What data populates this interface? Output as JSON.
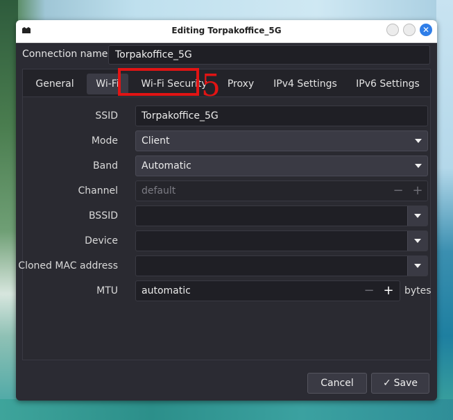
{
  "window": {
    "title": "Editing Torpakoffice_5G"
  },
  "connection": {
    "label": "Connection name",
    "value": "Torpakoffice_5G"
  },
  "tabs": [
    {
      "label": "General"
    },
    {
      "label": "Wi-Fi",
      "active": true
    },
    {
      "label": "Wi-Fi Security"
    },
    {
      "label": "Proxy"
    },
    {
      "label": "IPv4 Settings"
    },
    {
      "label": "IPv6 Settings"
    }
  ],
  "annotation": {
    "number": "5",
    "color": "#e11414"
  },
  "fields": {
    "ssid": {
      "label": "SSID",
      "value": "Torpakoffice_5G"
    },
    "mode": {
      "label": "Mode",
      "value": "Client"
    },
    "band": {
      "label": "Band",
      "value": "Automatic"
    },
    "channel": {
      "label": "Channel",
      "placeholder": "default",
      "minus": "−",
      "plus": "+"
    },
    "bssid": {
      "label": "BSSID",
      "value": ""
    },
    "device": {
      "label": "Device",
      "value": ""
    },
    "cloned_mac": {
      "label": "Cloned MAC address",
      "value": ""
    },
    "mtu": {
      "label": "MTU",
      "value": "automatic",
      "minus": "−",
      "plus": "+",
      "units": "bytes"
    }
  },
  "buttons": {
    "cancel": "Cancel",
    "save": "Save",
    "save_icon": "✓"
  },
  "colors": {
    "accent": "#2f7ee8",
    "window_bg": "#2b2b33"
  }
}
